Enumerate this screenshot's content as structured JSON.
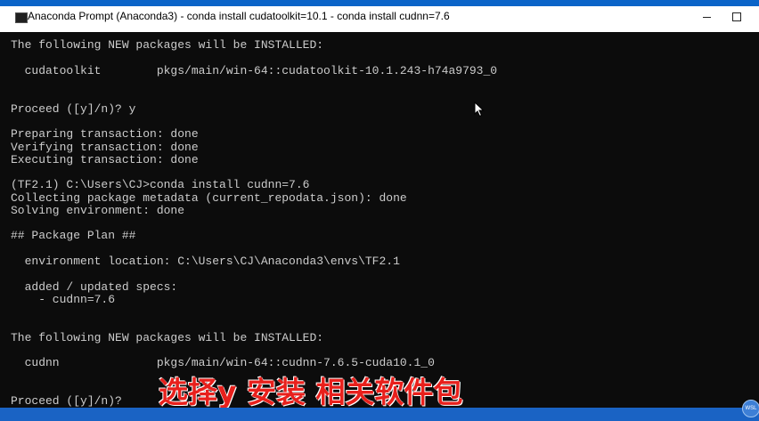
{
  "window": {
    "title": "Anaconda Prompt (Anaconda3) - conda  install cudatoolkit=10.1 - conda  install cudnn=7.6",
    "icon": "console-icon"
  },
  "console": {
    "lines": [
      "The following NEW packages will be INSTALLED:",
      "  cudatoolkit        pkgs/main/win-64::cudatoolkit-10.1.243-h74a9793_0",
      "Proceed ([y]/n)? y",
      "Preparing transaction: done",
      "Verifying transaction: done",
      "Executing transaction: done",
      "(TF2.1) C:\\Users\\CJ>conda install cudnn=7.6",
      "Collecting package metadata (current_repodata.json): done",
      "Solving environment: done",
      "## Package Plan ##",
      "  environment location: C:\\Users\\CJ\\Anaconda3\\envs\\TF2.1",
      "  added / updated specs:",
      "    - cudnn=7.6",
      "The following NEW packages will be INSTALLED:",
      "  cudnn              pkgs/main/win-64::cudnn-7.6.5-cuda10.1_0",
      "Proceed ([y]/n)?"
    ]
  },
  "overlay": {
    "subtitle": "选择y 安装 相关软件包"
  },
  "tray": {
    "badge": "WSL"
  },
  "colors": {
    "console_bg": "#0c0c0c",
    "console_text": "#cccccc",
    "subtitle": "#e8201c",
    "taskbar": "#1a63c4"
  }
}
